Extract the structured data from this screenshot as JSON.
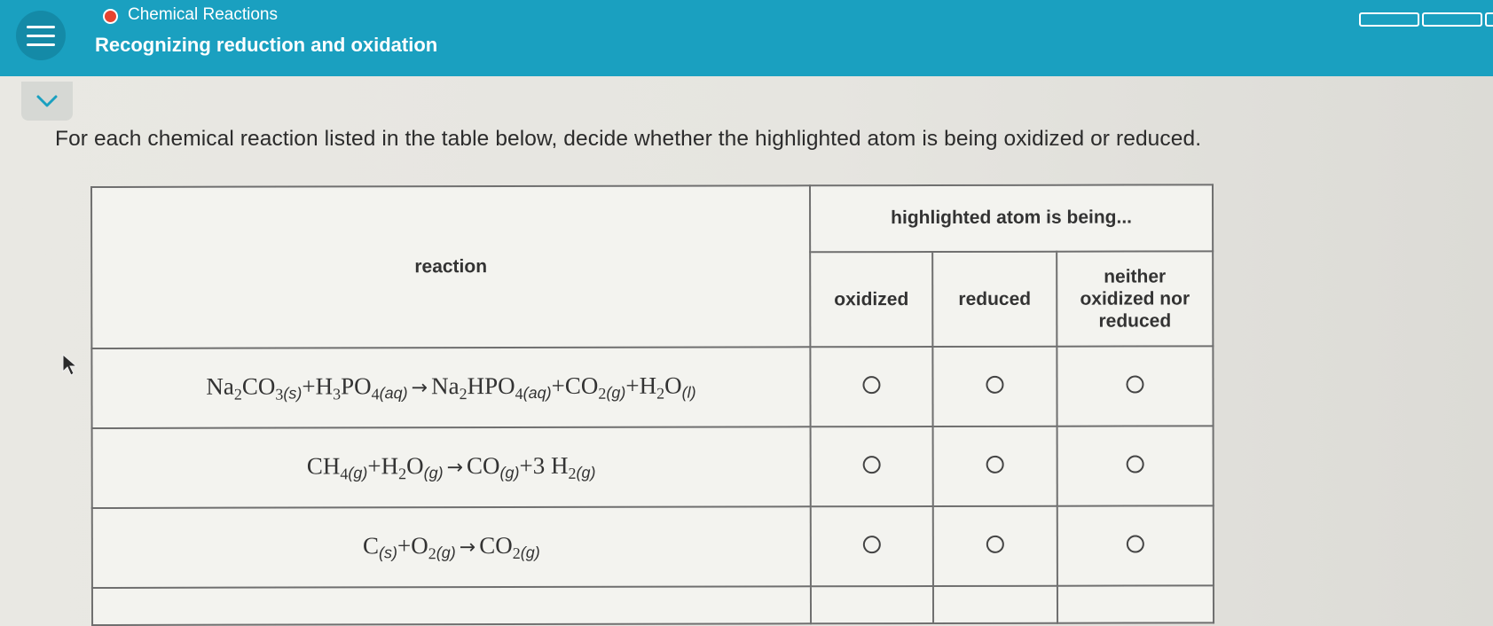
{
  "header": {
    "category": "Chemical Reactions",
    "title": "Recognizing reduction and oxidation",
    "status_color": "#e8432f",
    "bar_color": "#1aa0c0"
  },
  "instructions": "For each chemical reaction listed in the table below, decide whether the highlighted atom is being oxidized or reduced.",
  "table": {
    "col_reaction": "reaction",
    "col_group": "highlighted atom is being...",
    "col_oxidized": "oxidized",
    "col_reduced": "reduced",
    "col_neither": "neither oxidized nor reduced",
    "rows": [
      {
        "parts": [
          {
            "t": "Na"
          },
          {
            "sub": "2"
          },
          {
            "t": "CO"
          },
          {
            "sub": "3"
          },
          {
            "st": "(s)"
          },
          {
            "t": "+H"
          },
          {
            "sub": "3"
          },
          {
            "t": "PO"
          },
          {
            "sub": "4"
          },
          {
            "st": "(aq)"
          },
          {
            "ar": "→"
          },
          {
            "t": "Na"
          },
          {
            "sub": "2"
          },
          {
            "t": "HPO"
          },
          {
            "sub": "4"
          },
          {
            "st": "(aq)"
          },
          {
            "t": "+CO"
          },
          {
            "sub": "2"
          },
          {
            "st": "(g)"
          },
          {
            "t": "+H"
          },
          {
            "sub": "2"
          },
          {
            "t": "O"
          },
          {
            "st": "(l)"
          }
        ],
        "choice": null
      },
      {
        "parts": [
          {
            "t": "CH"
          },
          {
            "sub": "4"
          },
          {
            "st": "(g)"
          },
          {
            "t": "+H"
          },
          {
            "sub": "2"
          },
          {
            "t": "O"
          },
          {
            "st": "(g)"
          },
          {
            "ar": "→"
          },
          {
            "t": "CO"
          },
          {
            "st": "(g)"
          },
          {
            "t": "+3 H"
          },
          {
            "sub": "2"
          },
          {
            "st": "(g)"
          }
        ],
        "choice": null
      },
      {
        "parts": [
          {
            "t": "C"
          },
          {
            "st": "(s)"
          },
          {
            "t": "+O"
          },
          {
            "sub": "2"
          },
          {
            "st": "(g)"
          },
          {
            "ar": "→"
          },
          {
            "t": "CO"
          },
          {
            "sub": "2"
          },
          {
            "st": "(g)"
          }
        ],
        "choice": null
      }
    ]
  },
  "icons": [
    "menu-icon",
    "chevron-down-icon",
    "mouse-pointer-icon"
  ]
}
